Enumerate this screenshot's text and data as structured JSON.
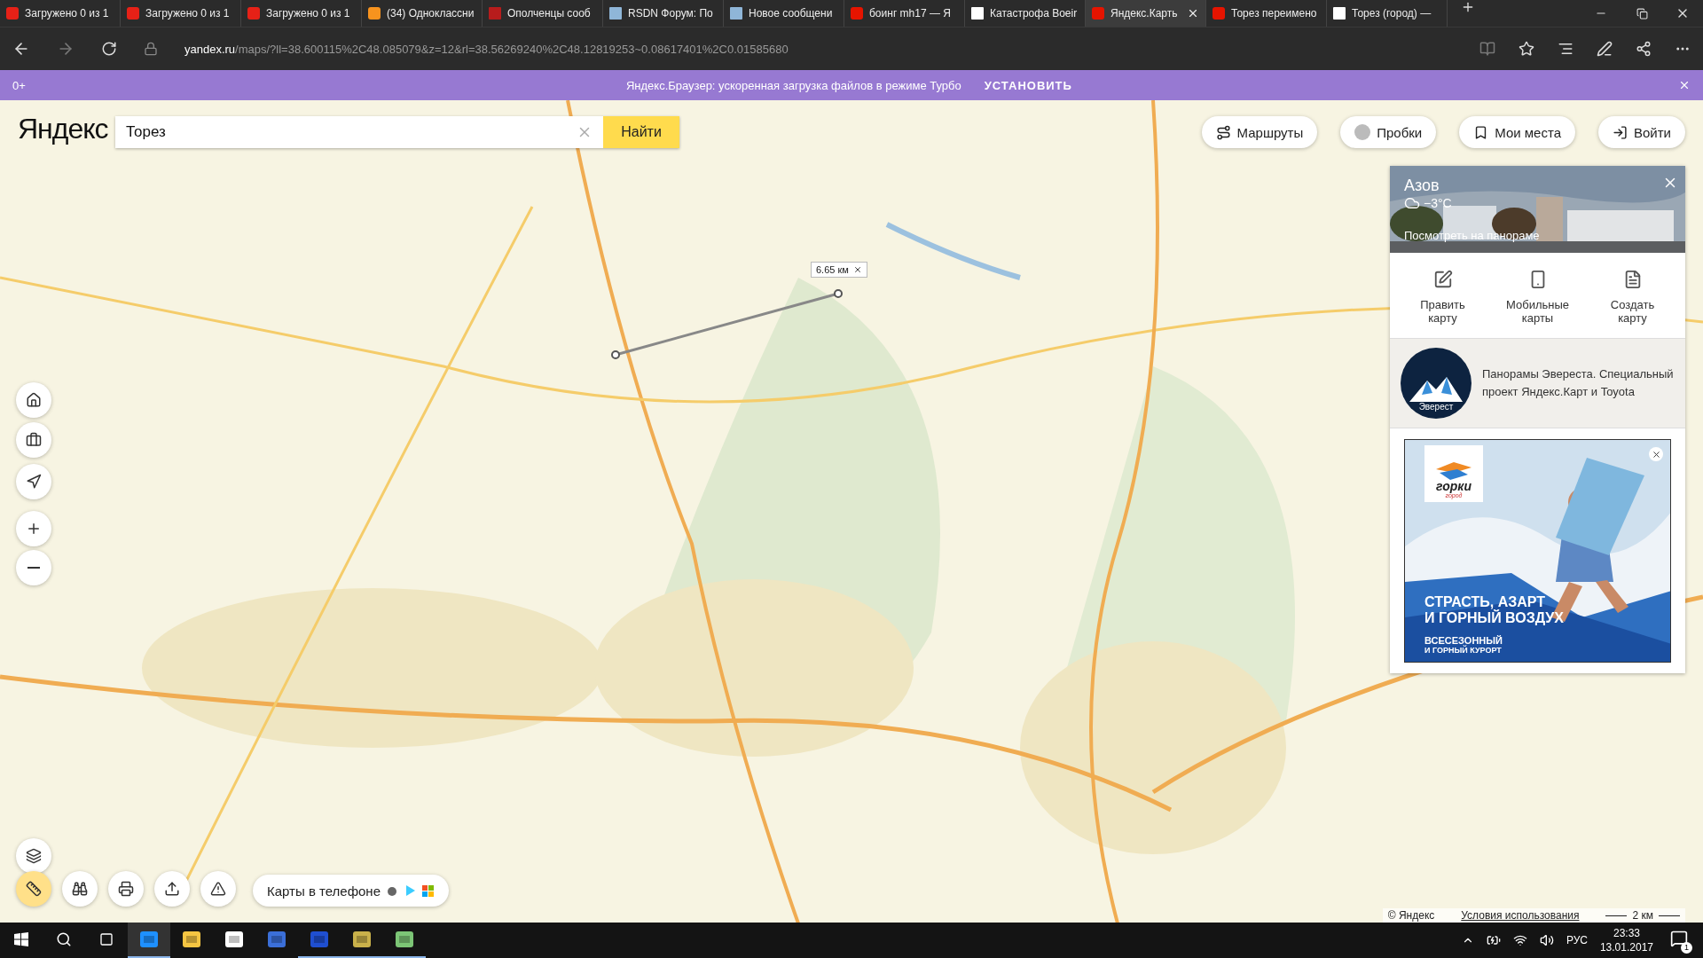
{
  "browser": {
    "tabs": [
      {
        "kind": "youtube",
        "title": "Загружено 0 из 1",
        "selected": false
      },
      {
        "kind": "youtube",
        "title": "Загружено 0 из 1",
        "selected": false
      },
      {
        "kind": "youtube",
        "title": "Загружено 0 из 1",
        "selected": false
      },
      {
        "kind": "ok",
        "title": "(34) Одноклассни",
        "selected": false
      },
      {
        "kind": "l1",
        "title": "Ополченцы сооб",
        "selected": false
      },
      {
        "kind": "rsdn",
        "title": "RSDN Форум: По",
        "selected": false
      },
      {
        "kind": "rsdn",
        "title": "Новое сообщени",
        "selected": false
      },
      {
        "kind": "yandex",
        "title": "боинг mh17 — Я",
        "selected": false
      },
      {
        "kind": "wiki",
        "title": "Катастрофа Boeir",
        "selected": false
      },
      {
        "kind": "yandex",
        "title": "Яндекс.Карть",
        "selected": true
      },
      {
        "kind": "yandex",
        "title": "Торез переимено",
        "selected": false
      },
      {
        "kind": "wiki",
        "title": "Торез (город) —",
        "selected": false
      }
    ],
    "address": {
      "host": "yandex.ru",
      "path": "/maps/?ll=38.600115%2C48.085079&z=12&rl=38.56269240%2C48.12819253~0.08617401%2C0.01585680"
    }
  },
  "banner": {
    "age": "0+",
    "message": "Яндекс.Браузер: ускоренная загрузка файлов в режиме Турбо",
    "action": "УСТАНОВИТЬ"
  },
  "map": {
    "logo": "Яндекс",
    "search": {
      "value": "Торез",
      "button": "Найти"
    },
    "top_buttons": [
      {
        "kind": "routes",
        "label": "Маршруты"
      },
      {
        "kind": "traffic",
        "label": "Пробки"
      },
      {
        "kind": "places",
        "label": "Мои места"
      },
      {
        "kind": "login",
        "label": "Войти"
      }
    ],
    "side_controls": [
      {
        "kind": "home"
      },
      {
        "kind": "briefcase"
      },
      {
        "kind": "locate"
      },
      {
        "kind": "zoom-in"
      },
      {
        "kind": "zoom-out"
      },
      {
        "kind": "layers"
      }
    ],
    "measurement": {
      "distance": "6.65 км"
    },
    "tools": [
      {
        "kind": "ruler",
        "selected": true
      },
      {
        "kind": "binoculars",
        "selected": false
      },
      {
        "kind": "print",
        "selected": false
      },
      {
        "kind": "share",
        "selected": false
      },
      {
        "kind": "warning",
        "selected": false
      }
    ],
    "apps_pill": {
      "label": "Карты в телефоне"
    },
    "footer": {
      "copyright": "© Яндекс",
      "terms": "Условия использования",
      "scale": "2 км"
    }
  },
  "panel": {
    "panorama": {
      "city": "Азов",
      "temperature": "−3°C",
      "link": "Посмотреть на панораме"
    },
    "actions": [
      {
        "kind": "edit",
        "label": "Править карту"
      },
      {
        "kind": "mobile",
        "label": "Мобильные карты"
      },
      {
        "kind": "create",
        "label": "Создать карту"
      }
    ],
    "promo": {
      "badge": "Эверест",
      "text": "Панорамы Эвереста. Специальный проект Яндекс.Карт и Toyota"
    },
    "ad": {
      "brand": "горки",
      "brand_sub": "город",
      "headline": [
        "СТРАСТЬ, АЗАРТ",
        "И ГОРНЫЙ ВОЗДУХ"
      ],
      "tagline": [
        "ВСЕСЕЗОННЫЙ",
        "И ГОРНЫЙ КУРОРТ"
      ]
    }
  },
  "taskbar": {
    "apps": [
      {
        "kind": "edge",
        "selected": true
      },
      {
        "kind": "explorer",
        "selected": false
      },
      {
        "kind": "store",
        "selected": false
      },
      {
        "kind": "grid",
        "selected": false
      },
      {
        "kind": "phone",
        "selected": false
      },
      {
        "kind": "video",
        "selected": false
      },
      {
        "kind": "notes",
        "selected": false
      }
    ],
    "tray": {
      "language": "РУС",
      "time": "23:33",
      "date": "13.01.2017",
      "notifications": "1"
    }
  }
}
